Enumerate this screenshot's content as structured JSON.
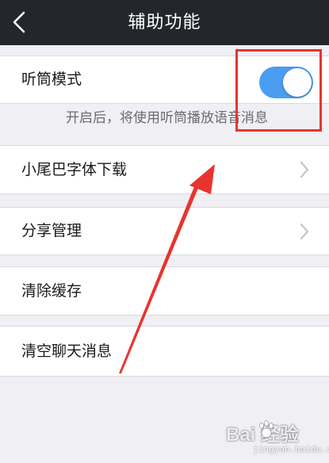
{
  "header": {
    "title": "辅助功能"
  },
  "settings": {
    "earpiece": {
      "label": "听筒模式",
      "enabled": true,
      "hint": "开启后，将使用听筒播放语音消息"
    },
    "items": [
      {
        "label": "小尾巴字体下载",
        "has_chevron": true
      },
      {
        "label": "分享管理",
        "has_chevron": true
      },
      {
        "label": "清除缓存",
        "has_chevron": false
      },
      {
        "label": "清空聊天消息",
        "has_chevron": false
      }
    ]
  },
  "watermark": {
    "main": "Bai 经验",
    "sub": "jingyan.baidu.com"
  },
  "colors": {
    "header_bg": "#23262b",
    "toggle_on": "#4a9df0",
    "annotation": "#e8342f",
    "background": "#efeff4"
  },
  "icons": {
    "back": "chevron-left-icon",
    "row": "chevron-right-icon",
    "watermark": "baidu-paw-icon"
  }
}
